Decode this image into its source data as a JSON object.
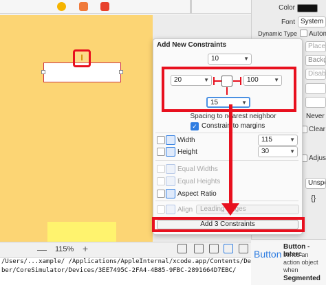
{
  "inspector": {
    "color_label": "Color",
    "font_label": "Font",
    "font_value": "System",
    "dynamic_type_label": "Dynamic Type",
    "dynamic_type_value": "Automatic",
    "placeholder_partial": "Placeho",
    "background_partial": "Backgro",
    "disabled_partial": "Disabled",
    "never_partial": "Never a",
    "clear_partial": "Clear",
    "adjust_partial": "Adjust",
    "unspec_partial": "Unspec",
    "braces": "{}",
    "button_title": "Button",
    "button_name": "Button - Interc",
    "button_desc": "sends an action object when",
    "seg_name": "Segmented",
    "colors": {
      "swatch": "#111111",
      "accent": "#2f7de1"
    }
  },
  "canvas": {
    "background": "#fcd574",
    "ibeam_glyph": "I"
  },
  "bottom_bar": {
    "zoom_minus": "—",
    "zoom_value": "115%",
    "zoom_plus": "+"
  },
  "console": {
    "line1": "/Users/...xample/ /Applications/AppleInternal/xcode.app/Contents/Develo",
    "line2": "ber/CoreSimulator/Devices/3EE7495C-2FA4-4B85-9FBC-2891664D7EBC/"
  },
  "popover": {
    "title": "Add New Constraints",
    "top_value": "10",
    "left_value": "20",
    "right_value": "100",
    "bottom_value": "15",
    "spacing_label": "Spacing to nearest neighbor",
    "constrain_margins": "Constrain to margins",
    "width_label": "Width",
    "width_value": "115",
    "height_label": "Height",
    "height_value": "30",
    "equal_widths": "Equal Widths",
    "equal_heights": "Equal Heights",
    "aspect_ratio": "Aspect Ratio",
    "align_label": "Align",
    "align_value": "Leading Edges",
    "add_button": "Add 3 Constraints",
    "highlight_color": "#e8101e"
  }
}
